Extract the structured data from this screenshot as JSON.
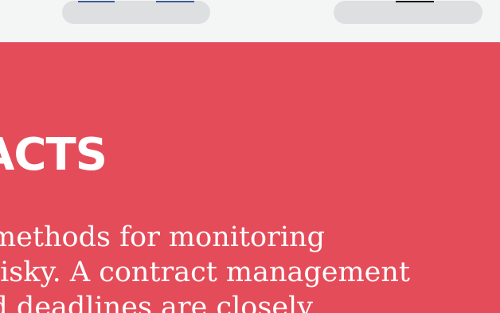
{
  "hero": {
    "heading": "ACTS",
    "body_lines": [
      "methods for monitoring",
      "isky. A contract management",
      "d deadlines are closely"
    ]
  },
  "colors": {
    "hero_background": "#e54c5a",
    "top_strip_background": "#f4f5f5",
    "pill_background": "#dddfe1",
    "text": "#ffffff"
  }
}
